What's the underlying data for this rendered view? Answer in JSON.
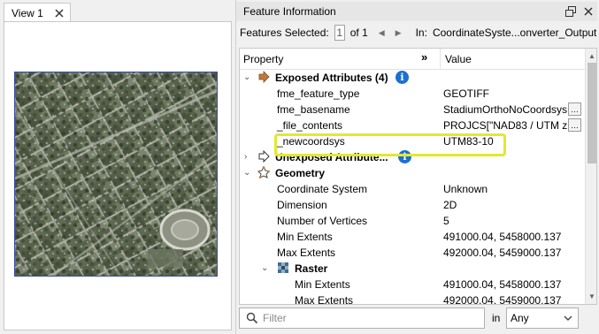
{
  "view": {
    "tab_label": "View 1"
  },
  "feature_info": {
    "title": "Feature Information",
    "selection": {
      "label": "Features Selected:",
      "index": "1",
      "total": "of 1",
      "in_label": "In:",
      "in_value": "CoordinateSyste...onverter_Output"
    },
    "columns": {
      "property": "Property",
      "expand": "»",
      "value": "Value"
    },
    "rows": [
      {
        "id": "exposed",
        "property": "Exposed Attributes (4)",
        "value": "",
        "type": "group",
        "icon": "arrow-right-icon",
        "info": true
      },
      {
        "id": "fme_feature_type",
        "property": "fme_feature_type",
        "value": "GEOTIFF",
        "type": "attr"
      },
      {
        "id": "fme_basename",
        "property": "fme_basename",
        "value": "StadiumOrthoNoCoordsys",
        "type": "attr",
        "more": true
      },
      {
        "id": "file_contents",
        "property": "_file_contents",
        "value": "PROJCS[\"NAD83 / UTM zo...",
        "type": "attr",
        "more": true
      },
      {
        "id": "newcoordsys",
        "property": "_newcoordsys",
        "value": "UTM83-10",
        "type": "attr",
        "highlighted": true
      },
      {
        "id": "unexposed",
        "property": "Unexposed Attribute...",
        "value": "",
        "type": "group",
        "icon": "outline-arrow-icon",
        "info": true,
        "collapsed": true
      },
      {
        "id": "geometry",
        "property": "Geometry",
        "value": "",
        "type": "group",
        "icon": "geometry-icon"
      },
      {
        "id": "coord_system",
        "property": "Coordinate System",
        "value": "Unknown",
        "type": "attr"
      },
      {
        "id": "dimension",
        "property": "Dimension",
        "value": "2D",
        "type": "attr"
      },
      {
        "id": "num_vertices",
        "property": "Number of Vertices",
        "value": "5",
        "type": "attr"
      },
      {
        "id": "min_extents",
        "property": "Min Extents",
        "value": "491000.04, 5458000.137",
        "type": "attr"
      },
      {
        "id": "max_extents",
        "property": "Max Extents",
        "value": "492000.04, 5459000.137",
        "type": "attr"
      },
      {
        "id": "raster",
        "property": "Raster",
        "value": "",
        "type": "subgroup",
        "icon": "raster-icon"
      },
      {
        "id": "raster_min",
        "property": "Min Extents",
        "value": "491000.04, 5458000.137",
        "type": "subattr"
      },
      {
        "id": "raster_max",
        "property": "Max Extents",
        "value": "492000.04, 5459000.137",
        "type": "subattr"
      }
    ],
    "filter": {
      "placeholder": "Filter",
      "in_label": "in",
      "scope_value": "Any"
    }
  },
  "colors": {
    "highlight": "#e3e830",
    "info_blue": "#1f6fd0",
    "raster_border": "#3a4aa0"
  }
}
